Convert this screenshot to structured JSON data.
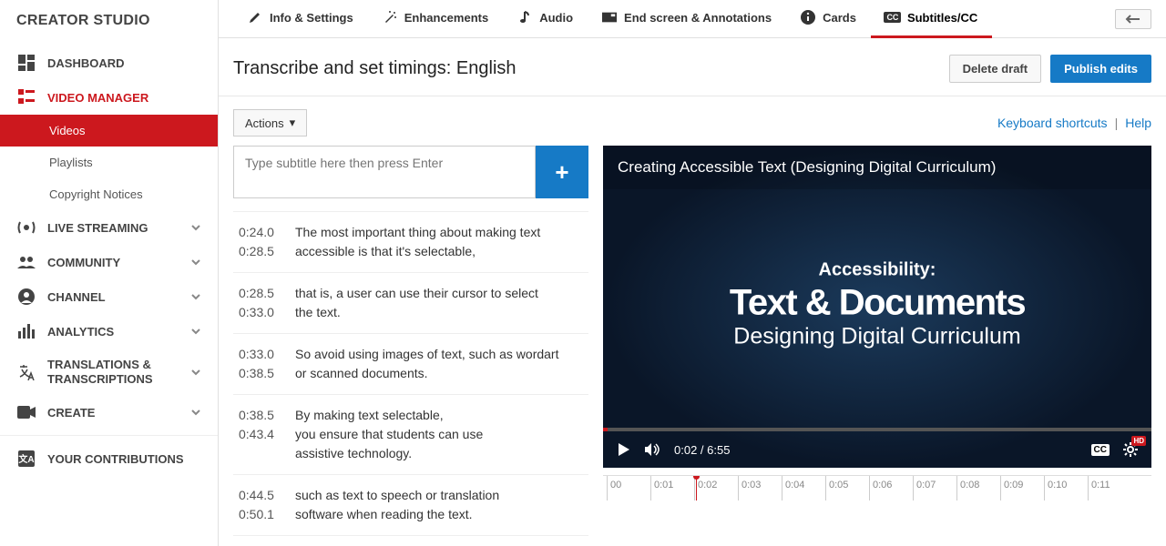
{
  "sidebar": {
    "title": "CREATOR STUDIO",
    "items": [
      {
        "label": "DASHBOARD",
        "icon": "dashboard"
      },
      {
        "label": "VIDEO MANAGER",
        "icon": "video-manager",
        "active": true,
        "subs": [
          {
            "label": "Videos",
            "highlight": true
          },
          {
            "label": "Playlists"
          },
          {
            "label": "Copyright Notices"
          }
        ]
      },
      {
        "label": "LIVE STREAMING",
        "icon": "live",
        "chev": true
      },
      {
        "label": "COMMUNITY",
        "icon": "community",
        "chev": true
      },
      {
        "label": "CHANNEL",
        "icon": "channel",
        "chev": true
      },
      {
        "label": "ANALYTICS",
        "icon": "analytics",
        "chev": true
      },
      {
        "label": "TRANSLATIONS &\nTRANSCRIPTIONS",
        "icon": "translate",
        "chev": true
      },
      {
        "label": "CREATE",
        "icon": "create",
        "chev": true
      },
      {
        "label": "YOUR CONTRIBUTIONS",
        "icon": "contrib",
        "divider": true
      }
    ]
  },
  "tabs": {
    "items": [
      {
        "label": "Info & Settings",
        "icon": "pencil"
      },
      {
        "label": "Enhancements",
        "icon": "wand"
      },
      {
        "label": "Audio",
        "icon": "note"
      },
      {
        "label": "End screen & Annotations",
        "icon": "endscreen"
      },
      {
        "label": "Cards",
        "icon": "info-circle"
      },
      {
        "label": "Subtitles/CC",
        "icon": "cc-badge",
        "active": true
      }
    ]
  },
  "header": {
    "title": "Transcribe and set timings: English",
    "delete_label": "Delete draft",
    "publish_label": "Publish edits"
  },
  "tools": {
    "actions_label": "Actions",
    "shortcuts_label": "Keyboard shortcuts",
    "help_label": "Help"
  },
  "input": {
    "placeholder": "Type subtitle here then press Enter"
  },
  "subs": [
    {
      "start": "0:24.0",
      "end": "0:28.5",
      "text": "The most important thing about making text\naccessible is that it's selectable,"
    },
    {
      "start": "0:28.5",
      "end": "0:33.0",
      "text": "that is, a user can use their cursor to select\nthe text."
    },
    {
      "start": "0:33.0",
      "end": "0:38.5",
      "text": "So avoid using images of text, such as wordart\nor scanned documents."
    },
    {
      "start": "0:38.5",
      "end": "0:43.4",
      "text": "By making text selectable,\nyou ensure that students can use\nassistive technology."
    },
    {
      "start": "0:44.5",
      "end": "0:50.1",
      "text": "such as text to speech or translation\nsoftware when reading the text."
    }
  ],
  "video": {
    "title": "Creating Accessible Text (Designing Digital Curriculum)",
    "line1": "Accessibility:",
    "line2": "Text & Documents",
    "line3": "Designing Digital Curriculum",
    "current_time": "0:02",
    "duration": "6:55",
    "time_display": "0:02 / 6:55",
    "cc_label": "CC",
    "hd_label": "HD"
  },
  "timeline": {
    "ticks": [
      "00",
      "0:01",
      "0:02",
      "0:03",
      "0:04",
      "0:05",
      "0:06",
      "0:07",
      "0:08",
      "0:09",
      "0:10",
      "0:11"
    ]
  }
}
